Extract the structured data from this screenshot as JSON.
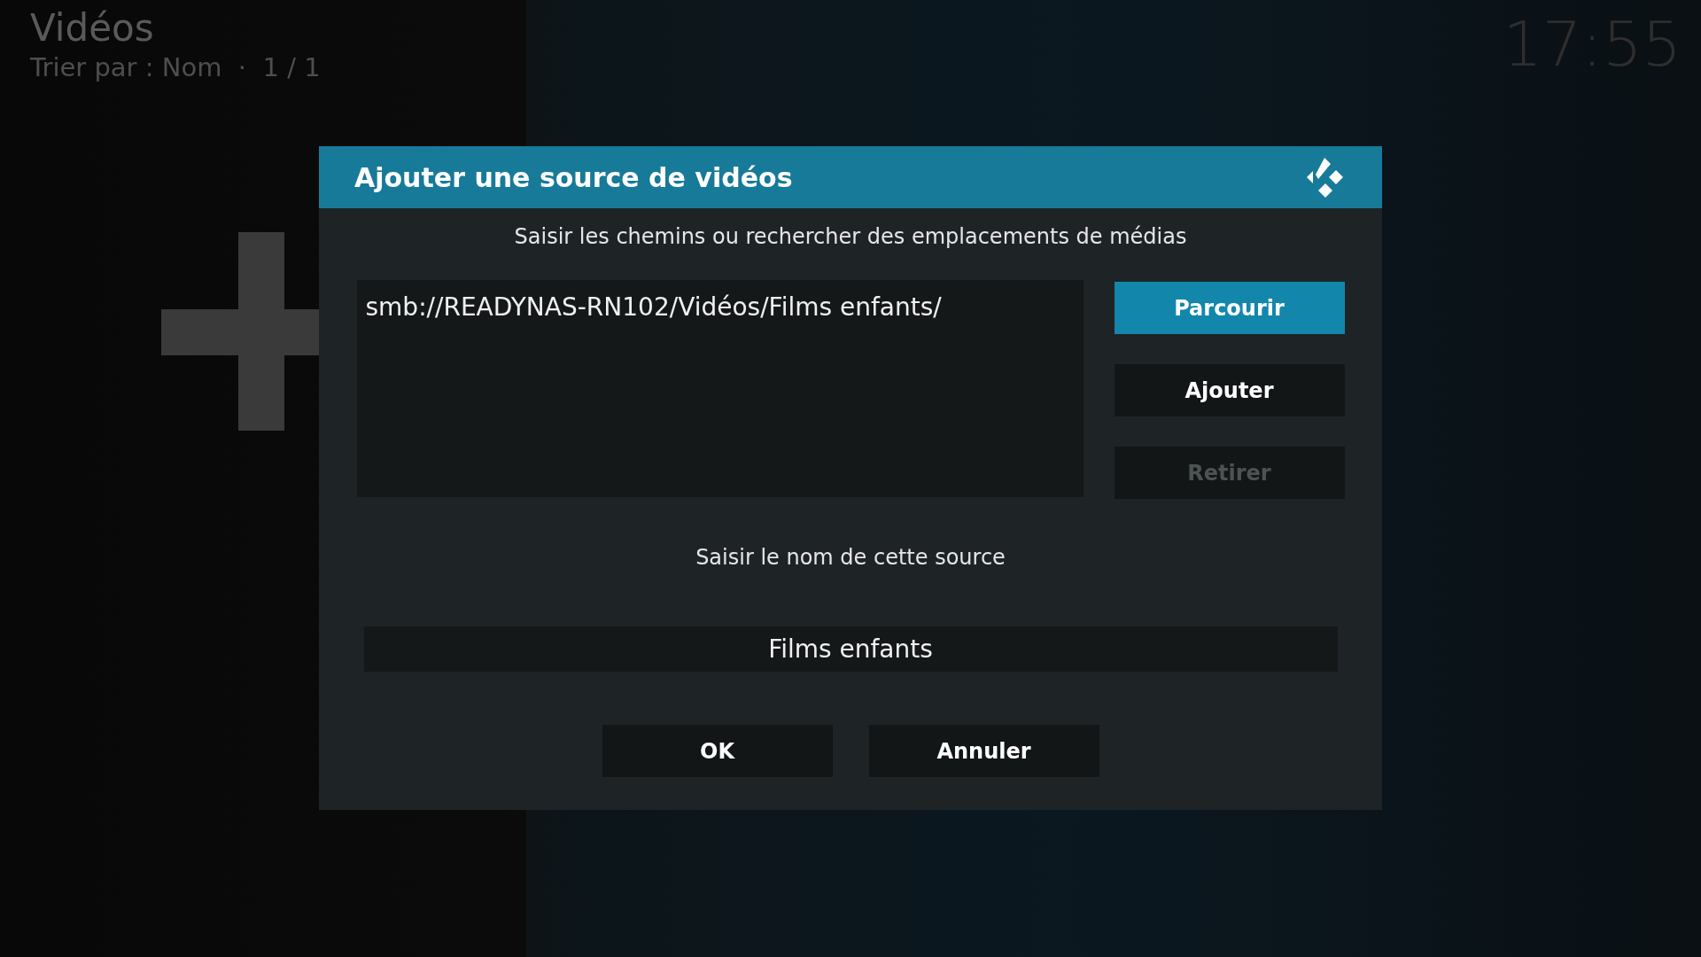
{
  "header": {
    "title": "Vidéos",
    "sort_info": "Trier par : Nom  ·  1 / 1",
    "clock": "17:55"
  },
  "dialog": {
    "title": "Ajouter une source de vidéos",
    "paths_hint": "Saisir les chemins ou rechercher des emplacements de médias",
    "paths": [
      "smb://READYNAS-RN102/Vidéos/Films enfants/"
    ],
    "side_buttons": [
      {
        "label": "Parcourir",
        "focused": true,
        "disabled": false
      },
      {
        "label": "Ajouter",
        "focused": false,
        "disabled": false
      },
      {
        "label": "Retirer",
        "focused": false,
        "disabled": true
      }
    ],
    "name_hint": "Saisir le nom de cette source",
    "name_value": "Films enfants",
    "buttons": [
      {
        "label": "OK",
        "focused": false
      },
      {
        "label": "Annuler",
        "focused": false
      }
    ]
  }
}
